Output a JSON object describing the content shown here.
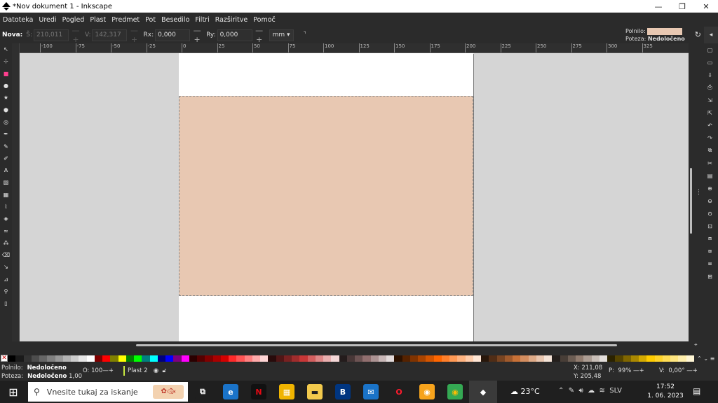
{
  "window": {
    "title": "*Nov dokument 1 - Inkscape",
    "minimize": "—",
    "maximize": "❐",
    "close": "✕"
  },
  "menu": [
    "Datoteka",
    "Uredi",
    "Pogled",
    "Plast",
    "Predmet",
    "Pot",
    "Besedilo",
    "Filtri",
    "Razširitve",
    "Pomoč"
  ],
  "tool_controls": {
    "new_label": "Nova:",
    "w_label": "Š:",
    "w_value": "210,011",
    "h_label": "V:",
    "h_value": "142,317",
    "rx_label": "Rx:",
    "rx_value": "0,000",
    "ry_label": "Ry:",
    "ry_value": "0,000",
    "unit": "mm",
    "fill_label": "Polnilo:",
    "stroke_label": "Poteza:",
    "stroke_value": "Nedoločeno",
    "fill_color": "#e8c8b2"
  },
  "ruler_ticks": [
    "-100",
    "-75",
    "-50",
    "-25",
    "0",
    "25",
    "50",
    "75",
    "100",
    "125",
    "150",
    "175",
    "200",
    "225",
    "250",
    "275",
    "300",
    "325"
  ],
  "tools": [
    "selector-icon",
    "node-icon",
    "rectangle-icon",
    "ellipse-icon",
    "star-icon",
    "3dbox-icon",
    "spiral-icon",
    "pen-icon",
    "pencil-icon",
    "calligraphy-icon",
    "text-icon",
    "gradient-icon",
    "mesh-icon",
    "dropper-icon",
    "paint-bucket-icon",
    "tweak-icon",
    "spray-icon",
    "eraser-icon",
    "connector-icon",
    "measure-icon",
    "zoom-icon",
    "pages-icon"
  ],
  "commands": [
    "new-icon",
    "open-icon",
    "save-icon",
    "print-icon",
    "import-icon",
    "export-icon",
    "undo-icon",
    "redo-icon",
    "copy-icon",
    "cut-icon",
    "paste-icon",
    "zoom-selection-icon",
    "zoom-drawing-icon",
    "zoom-page-icon",
    "zoom-center-icon",
    "duplicate-icon",
    "clone-icon",
    "unlink-clone-icon",
    "group-icon"
  ],
  "palette_colors": [
    "#000000",
    "#1a1a1a",
    "#333333",
    "#4d4d4d",
    "#666666",
    "#808080",
    "#999999",
    "#b3b3b3",
    "#cccccc",
    "#e6e6e6",
    "#ffffff",
    "#800000",
    "#ff0000",
    "#808000",
    "#ffff00",
    "#008000",
    "#00ff00",
    "#008080",
    "#00ffff",
    "#000080",
    "#0000ff",
    "#800080",
    "#ff00ff",
    "#2b0000",
    "#550000",
    "#800000",
    "#aa0000",
    "#d40000",
    "#ff2a2a",
    "#ff5555",
    "#ff8080",
    "#ffaaaa",
    "#ffd5d5",
    "#280b0b",
    "#501616",
    "#782121",
    "#a02c2c",
    "#c83737",
    "#d35f5f",
    "#de8787",
    "#e9afaf",
    "#f4d7d7",
    "#241c1c",
    "#483737",
    "#6c5353",
    "#916f6f",
    "#ac9393",
    "#c8b7b7",
    "#e3dbdb",
    "#2b1100",
    "#552200",
    "#803300",
    "#aa4400",
    "#d45500",
    "#ff6600",
    "#ff7f2a",
    "#ff9955",
    "#ffb380",
    "#ffccaa",
    "#ffe6d5",
    "#28170b",
    "#502d16",
    "#784421",
    "#a05a2c",
    "#c87137",
    "#d38d5f",
    "#deaa87",
    "#e9c6af",
    "#f4e3d7",
    "#241f1c",
    "#483e37",
    "#6c5d53",
    "#917c6f",
    "#ac9d93",
    "#c8beb7",
    "#e3dedb",
    "#2b2200",
    "#554400",
    "#806600",
    "#aa8800",
    "#d4aa00",
    "#ffcc00",
    "#ffd42a",
    "#ffdd55",
    "#ffe680",
    "#ffeeaa",
    "#fff6d5"
  ],
  "status": {
    "fill_label": "Polnilo:",
    "fill_value": "Nedoločeno",
    "stroke_label": "Poteza:",
    "stroke_value": "Nedoločeno",
    "stroke_width": "1,00",
    "opacity_label": "O:",
    "opacity_value": "100",
    "layer": "Plast 2",
    "x_label": "X:",
    "x_value": "211,08",
    "y_label": "Y:",
    "y_value": "205,48",
    "zoom_label": "P:",
    "zoom_value": "99%",
    "rot_label": "V:",
    "rot_value": "0,00°"
  },
  "taskbar": {
    "search_placeholder": "Vnesite tukaj za iskanje",
    "weather": "23°C",
    "language": "SLV",
    "time": "17:52",
    "date": "1. 06. 2023",
    "icons": [
      {
        "name": "task-view-icon",
        "glyph": "⧉",
        "bg": "#1f1f1f",
        "fg": "#ffffff"
      },
      {
        "name": "edge-icon",
        "glyph": "e",
        "bg": "#1a73c8",
        "fg": "#ffffff"
      },
      {
        "name": "netflix-icon",
        "glyph": "N",
        "bg": "#111111",
        "fg": "#e50914"
      },
      {
        "name": "store-icon",
        "glyph": "▦",
        "bg": "#f0b400",
        "fg": "#ffffff"
      },
      {
        "name": "file-explorer-icon",
        "glyph": "▬",
        "bg": "#f2c94c",
        "fg": "#1f1f1f"
      },
      {
        "name": "booking-icon",
        "glyph": "B",
        "bg": "#003580",
        "fg": "#ffffff"
      },
      {
        "name": "mail-icon",
        "glyph": "✉",
        "bg": "#1a73c8",
        "fg": "#ffffff"
      },
      {
        "name": "opera-icon",
        "glyph": "O",
        "bg": "#1f1f1f",
        "fg": "#ff1b2d"
      },
      {
        "name": "avast-browser-icon",
        "glyph": "◉",
        "bg": "#f7a31c",
        "fg": "#ffffff"
      },
      {
        "name": "chrome-icon",
        "glyph": "◉",
        "bg": "#34a853",
        "fg": "#fbbc05"
      },
      {
        "name": "inkscape-icon",
        "glyph": "◆",
        "bg": "#3a3a3a",
        "fg": "#ffffff"
      }
    ]
  }
}
